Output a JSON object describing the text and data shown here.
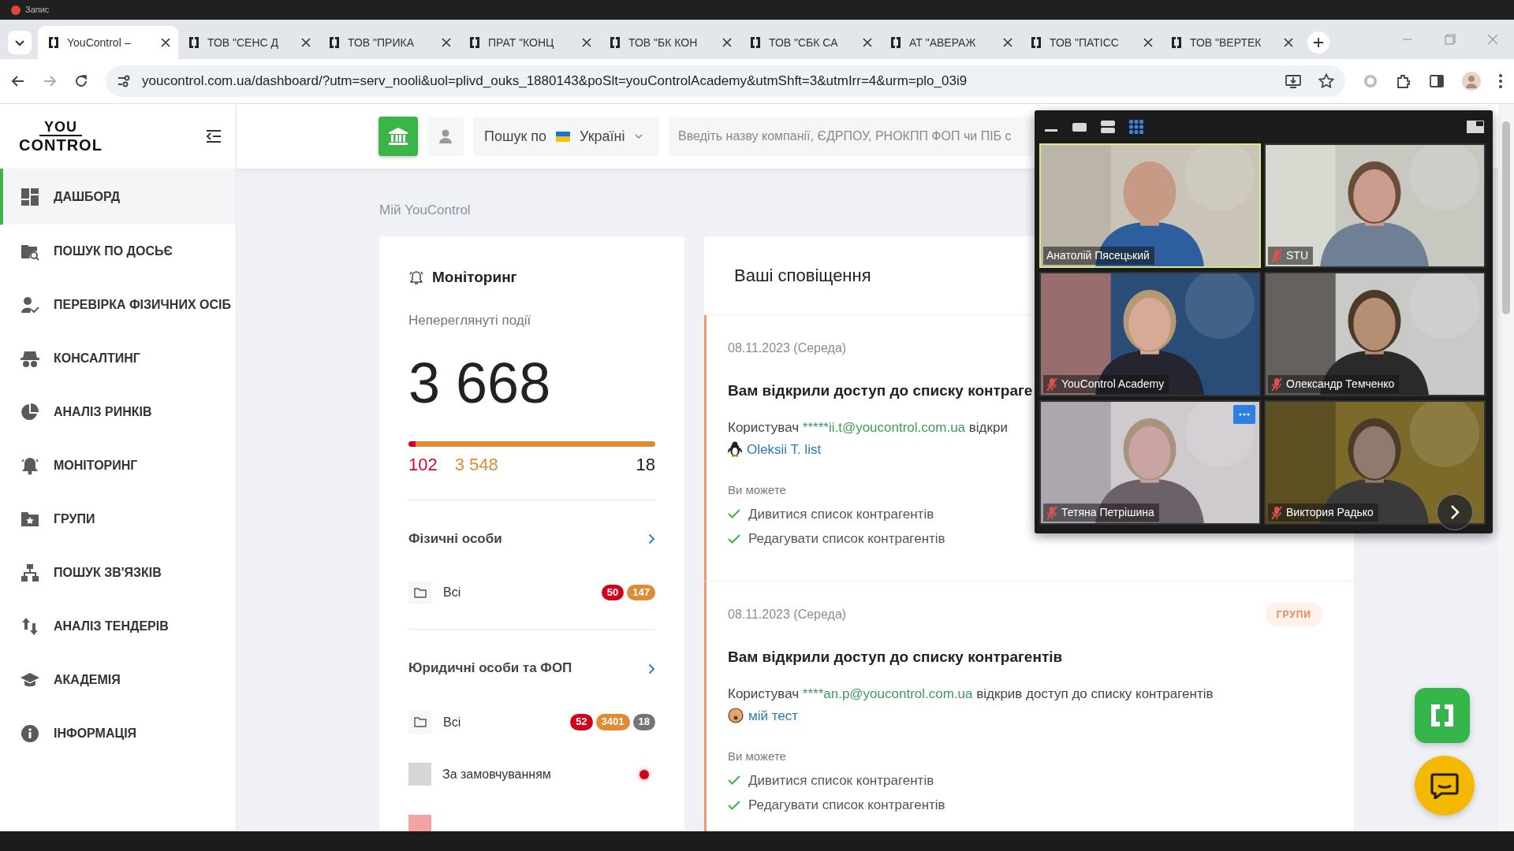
{
  "recording": {
    "label": "Запис"
  },
  "browser": {
    "tabs": [
      {
        "title": "YouControl –",
        "selected": true
      },
      {
        "title": "ТОВ \"СЕНС Д",
        "selected": false
      },
      {
        "title": "ТОВ \"ПРИКА",
        "selected": false
      },
      {
        "title": "ПРАТ \"КОНЦ",
        "selected": false
      },
      {
        "title": "ТОВ \"БК КОН",
        "selected": false
      },
      {
        "title": "ТОВ \"СБК СА",
        "selected": false
      },
      {
        "title": "АТ \"АВЕРАЖ",
        "selected": false
      },
      {
        "title": "ТОВ \"ПАТІСС",
        "selected": false
      },
      {
        "title": "ТОВ \"ВЕРТЕК",
        "selected": false
      }
    ],
    "url": "youcontrol.com.ua/dashboard/?utm=serv_nooli&uol=plivd_ouks_1880143&poSlt=youControlAcademy&utmShft=3&utmIrr=4&urm=plo_03i9"
  },
  "sidebar": {
    "logo_top": "YOU",
    "logo_bottom": "CONTROL",
    "items": [
      {
        "label": "ДАШБОРД",
        "selected": true
      },
      {
        "label": "ПОШУК ПО ДОСЬЄ",
        "selected": false
      },
      {
        "label": "ПЕРЕВІРКА ФІЗИЧНИХ ОСІБ",
        "selected": false
      },
      {
        "label": "КОНСАЛТИНГ",
        "selected": false
      },
      {
        "label": "АНАЛІЗ РИНКІВ",
        "selected": false
      },
      {
        "label": "МОНІТОРИНГ",
        "selected": false
      },
      {
        "label": "ГРУПИ",
        "selected": false
      },
      {
        "label": "ПОШУК ЗВ'ЯЗКІВ",
        "selected": false
      },
      {
        "label": "АНАЛІЗ ТЕНДЕРІВ",
        "selected": false
      },
      {
        "label": "АКАДЕМІЯ",
        "selected": false
      },
      {
        "label": "ІНФОРМАЦІЯ",
        "selected": false
      }
    ]
  },
  "search": {
    "scope_label": "Пошук по",
    "country": "Україні",
    "placeholder": "Введіть назву компанії, ЄДРПОУ, РНОКПП ФОП чи ПІБ с"
  },
  "breadcrumb": "Мій YouControl",
  "monitoring": {
    "title": "Моніторинг",
    "subtitle": "Непереглянуті події",
    "total": "3 668",
    "bar": [
      {
        "level": 0.03,
        "color": "#d0021b"
      },
      {
        "level": 0.97,
        "color": "#e08b35"
      }
    ],
    "counts": [
      {
        "value": "102",
        "color": "#c8102e"
      },
      {
        "value": "3 548",
        "color": "#e08b35"
      },
      {
        "value": "18",
        "color": "#212121"
      }
    ],
    "sections": [
      {
        "title": "Фізичні особи",
        "items": [
          {
            "kind": "folder",
            "label": "Всі",
            "badges": [
              {
                "value": "50",
                "color": "#d0021b"
              },
              {
                "value": "147",
                "color": "#e08b35"
              }
            ]
          }
        ]
      },
      {
        "title": "Юридичні особи та ФОП",
        "items": [
          {
            "kind": "folder",
            "label": "Всі",
            "badges": [
              {
                "value": "52",
                "color": "#d0021b"
              },
              {
                "value": "3401",
                "color": "#e08b35"
              },
              {
                "value": "18",
                "color": "#757575"
              }
            ]
          },
          {
            "kind": "swatch",
            "color": "#d6d6d6",
            "label": "За замовчуванням",
            "alert": true
          },
          {
            "kind": "swatch",
            "color": "#f4a3a3",
            "alert": false
          }
        ]
      }
    ]
  },
  "notifications": {
    "title": "Ваші сповіщення",
    "items": [
      {
        "date": "08.11.2023 (Середа)",
        "title": "Вам відкрили доступ до списку контраге",
        "user_prefix": "Користувач",
        "email": "*****ii.t@youcontrol.com.ua",
        "message": "відкри",
        "list_name": "Oleksii T. list",
        "can_label": "Ви можете",
        "permissions": [
          "Дивитися список контрагентів",
          "Редагувати список контрагентів"
        ]
      },
      {
        "date": "08.11.2023 (Середа)",
        "tag": "ГРУПИ",
        "title": "Вам відкрили доступ до списку контрагентів",
        "user_prefix": "Користувач",
        "email": "****an.p@youcontrol.com.ua",
        "message": "відкрив доступ до списку контрагентів",
        "list_name": "мій тест",
        "can_label": "Ви можете",
        "permissions": [
          "Дивитися список контрагентів",
          "Редагувати список контрагентів"
        ]
      }
    ]
  },
  "video_call": {
    "view_modes": [
      {
        "selected": false
      },
      {
        "selected": false
      },
      {
        "selected": false
      },
      {
        "selected": true
      }
    ],
    "tiles": [
      {
        "name": "Анатолій Пясецький",
        "muted": false,
        "speaking": true,
        "hovered": false
      },
      {
        "name": "STU",
        "muted": true,
        "speaking": false,
        "hovered": false
      },
      {
        "name": "YouControl Academy",
        "muted": true,
        "speaking": false,
        "hovered": false
      },
      {
        "name": "Олександр Темченко",
        "muted": true,
        "speaking": false,
        "hovered": false
      },
      {
        "name": "Тетяна Петрішина",
        "muted": true,
        "speaking": false,
        "hovered": true
      },
      {
        "name": "Виктория Радько",
        "muted": true,
        "speaking": false,
        "hovered": false
      }
    ]
  }
}
